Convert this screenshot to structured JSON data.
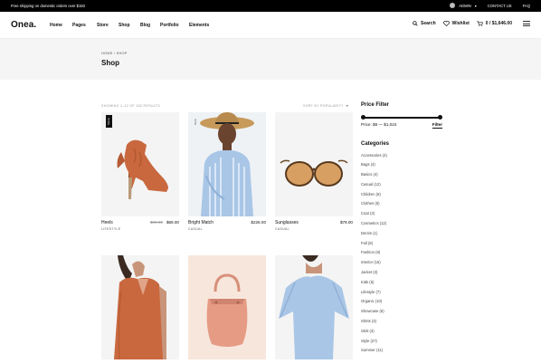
{
  "topbar": {
    "shipping": "Free shipping on domestic orders over $150",
    "admin": "ADMIN",
    "contact": "CONTACT US",
    "faq": "FAQ"
  },
  "header": {
    "logo": "Onea.",
    "nav": [
      "Home",
      "Pages",
      "Store",
      "Shop",
      "Blog",
      "Portfolio",
      "Elements"
    ],
    "search_label": "Search",
    "wishlist_label": "Wishlist",
    "cart_label": "0 / $1,646.00"
  },
  "page": {
    "breadcrumb": "HOME / SHOP",
    "title": "Shop",
    "results": "SHOWING 1–12 OF 182 RESULTS",
    "sort": "SORT BY POPULARITY"
  },
  "products": [
    {
      "name": "Heels",
      "category": "LIFESTYLE",
      "old_price": "$99.00",
      "price": "$69.00",
      "badge": "SALE",
      "bg": "#f4f4f4"
    },
    {
      "name": "Bright Match",
      "category": "CASUAL",
      "old_price": "",
      "price": "$226.00",
      "badge": "NEW",
      "bg": "#eef2f5"
    },
    {
      "name": "Sunglasses",
      "category": "CASUAL",
      "old_price": "",
      "price": "$79.00",
      "badge": "",
      "bg": "#f4f4f4"
    },
    {
      "name": "",
      "category": "",
      "old_price": "",
      "price": "",
      "badge": "",
      "bg": "#f4f4f4"
    },
    {
      "name": "",
      "category": "",
      "old_price": "",
      "price": "",
      "badge": "",
      "bg": "#f7e6db"
    },
    {
      "name": "",
      "category": "",
      "old_price": "",
      "price": "",
      "badge": "",
      "bg": "#f4f4f4"
    }
  ],
  "sidebar": {
    "price_heading": "Price Filter",
    "price_range": "Price: $6 — $1,024",
    "filter_label": "Filter",
    "categories_heading": "Categories",
    "categories": [
      "Accessories (4)",
      "Bags (4)",
      "Basics (4)",
      "Casual (12)",
      "Children (8)",
      "Clothes (8)",
      "Coat (3)",
      "Cosmetics (12)",
      "Denim (1)",
      "Fall (8)",
      "Fashion (8)",
      "Interior (16)",
      "Jacket (3)",
      "Kids (5)",
      "Lifestyle (7)",
      "Organic (10)",
      "Showcase (6)",
      "Shirts (3)",
      "Skirt (3)",
      "Style (27)",
      "Summer (11)"
    ]
  },
  "colors": {
    "accent": "#111111",
    "product_orange": "#c9683f",
    "shirt_blue": "#a9c6e6",
    "tan": "#d7a062"
  }
}
